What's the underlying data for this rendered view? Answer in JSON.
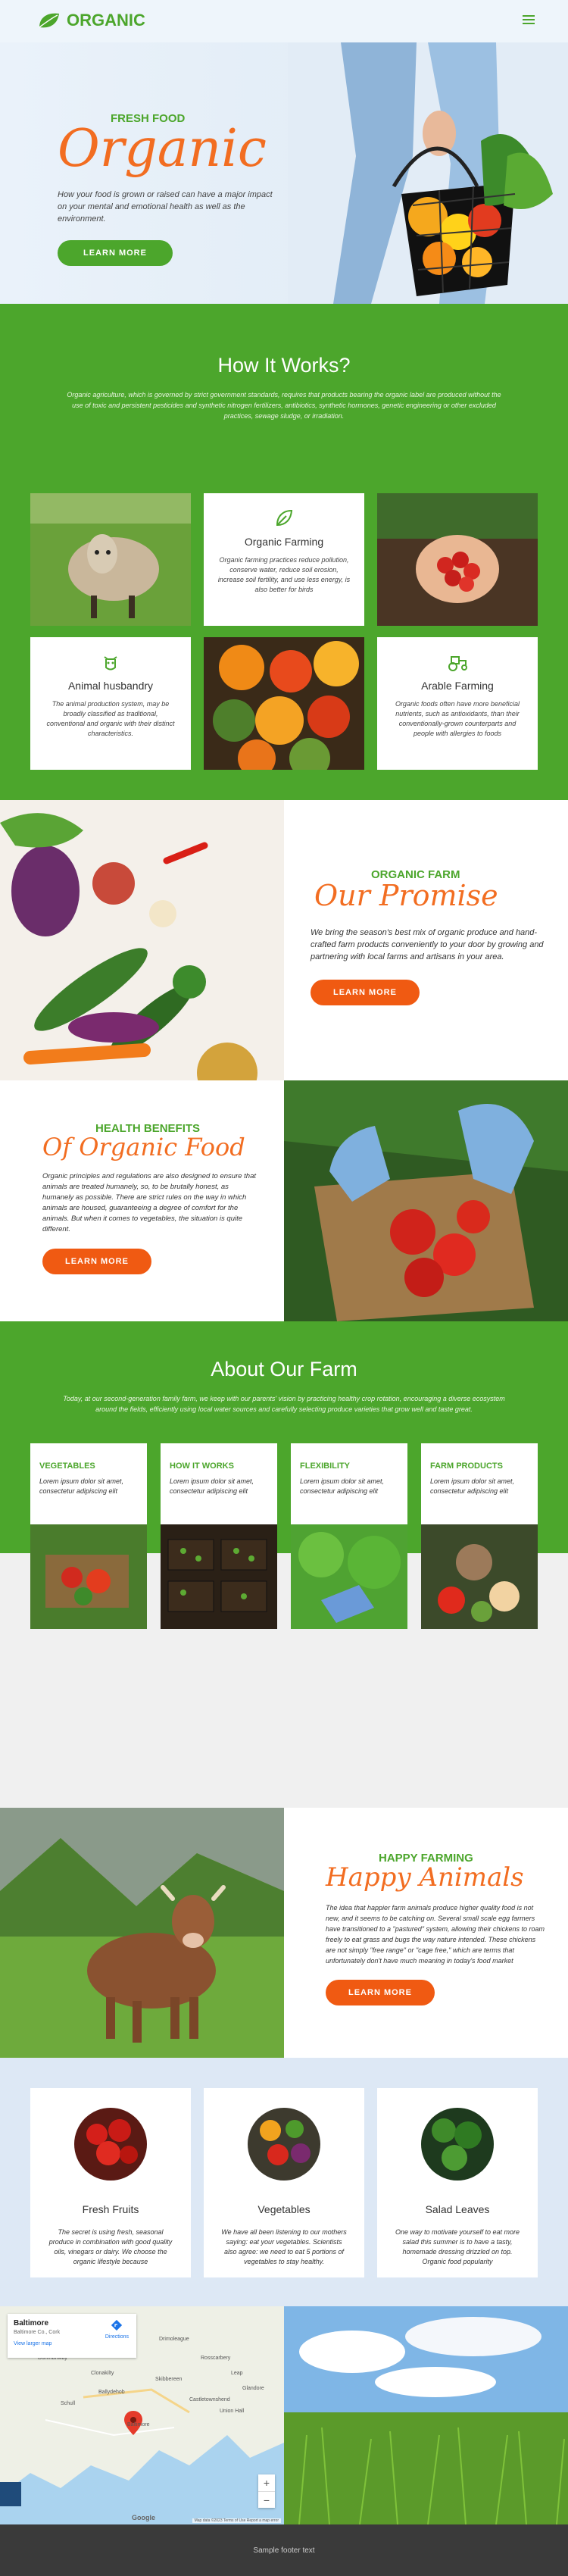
{
  "header": {
    "logo_text": "ORGANIC"
  },
  "hero": {
    "subtitle": "FRESH FOOD",
    "title": "Organic",
    "text": "How your food is grown or raised can have a major impact on your mental and emotional health as well as the environment.",
    "button": "LEARN MORE"
  },
  "how": {
    "title": "How It Works?",
    "intro": "Organic agriculture, which is governed by strict government standards, requires that products bearing the organic label are produced without the use of toxic and persistent pesticides and synthetic nitrogen fertilizers, antibiotics, synthetic hormones, genetic engineering or other excluded practices, sewage sludge, or irradiation.",
    "cards": [
      {
        "title": "Organic Farming",
        "text": "Organic farming practices reduce pollution, conserve water, reduce soil erosion, increase soil fertility, and use less energy, is also better for birds"
      },
      {
        "title": "Animal husbandry",
        "text": "The animal production system, may be broadly classified as traditional, conventional and organic with their distinct characteristics."
      },
      {
        "title": "Arable Farming",
        "text": "Organic foods often have more beneficial nutrients, such as antioxidants, than their conventionally-grown counterparts and people with allergies to foods"
      }
    ]
  },
  "promise": {
    "label": "ORGANIC FARM",
    "title": "Our Promise",
    "text": "We bring the season's best mix of organic produce and hand-crafted farm products conveniently to your door by growing and partnering with local farms and artisans in your area.",
    "button": "LEARN MORE"
  },
  "health": {
    "label": "HEALTH BENEFITS",
    "title": "Of Organic Food",
    "text": "Organic principles and regulations are also designed to ensure that animals are treated humanely, so, to be brutally honest, as humanely as possible. There are strict rules on the way in which animals are housed, guaranteeing a degree of comfort for the animals. But when it comes to vegetables, the situation is quite different.",
    "button": "LEARN MORE"
  },
  "about": {
    "title": "About Our Farm",
    "intro": "Today, at our second-generation family farm, we keep with our parents' vision by practicing healthy crop rotation, encouraging a diverse ecosystem around the fields, efficiently using local water sources and carefully selecting produce varieties that grow well and taste great.",
    "cols": [
      {
        "title": "VEGETABLES",
        "text": "Lorem ipsum dolor sit amet, consectetur adipiscing elit"
      },
      {
        "title": "HOW IT WORKS",
        "text": "Lorem ipsum dolor sit amet, consectetur adipiscing elit"
      },
      {
        "title": "FLEXIBILITY",
        "text": "Lorem ipsum dolor sit amet, consectetur adipiscing elit"
      },
      {
        "title": "FARM PRODUCTS",
        "text": "Lorem ipsum dolor sit amet, consectetur adipiscing elit"
      }
    ]
  },
  "happy": {
    "label": "HAPPY FARMING",
    "title": "Happy Animals",
    "text": "The idea that happier farm animals produce higher quality food is not new, and it seems to be catching on. Several small scale egg farmers have transitioned to a \"pastured\" system, allowing their chickens to roam freely to eat grass and bugs the way nature intended. These chickens are not simply \"free range\" or \"cage free,\" which are terms that unfortunately don't have much meaning in today's food market",
    "button": "LEARN MORE"
  },
  "products": [
    {
      "title": "Fresh Fruits",
      "text": "The secret is using fresh, seasonal produce in combination with good quality oils, vinegars or dairy. We choose the organic lifestyle because"
    },
    {
      "title": "Vegetables",
      "text": "We have all been listening to our mothers saying: eat your vegetables. Scientists also agree: we need to eat 5 portions of vegetables to stay healthy."
    },
    {
      "title": "Salad Leaves",
      "text": "One way to motivate yourself to eat more salad this summer is to have a tasty, homemade dressing drizzled on top. Organic food popularity"
    }
  ],
  "map": {
    "place": "Baltimore",
    "place_sub": "Baltimore Co., Cork",
    "directions": "Directions",
    "larger": "View larger map",
    "zoom_in": "+",
    "zoom_out": "−",
    "google": "Google",
    "attribution": "Map data ©2023   Terms of Use   Report a map error",
    "labels": [
      "Dunmanway",
      "Clonakilty",
      "Skibbereen",
      "Rosscarbery",
      "Schull",
      "Castletownshend",
      "Ballydehob",
      "Baltimore",
      "Glandore",
      "Drimoleague",
      "Leap",
      "Union Hall"
    ]
  },
  "footer": {
    "text": "Sample footer text"
  }
}
